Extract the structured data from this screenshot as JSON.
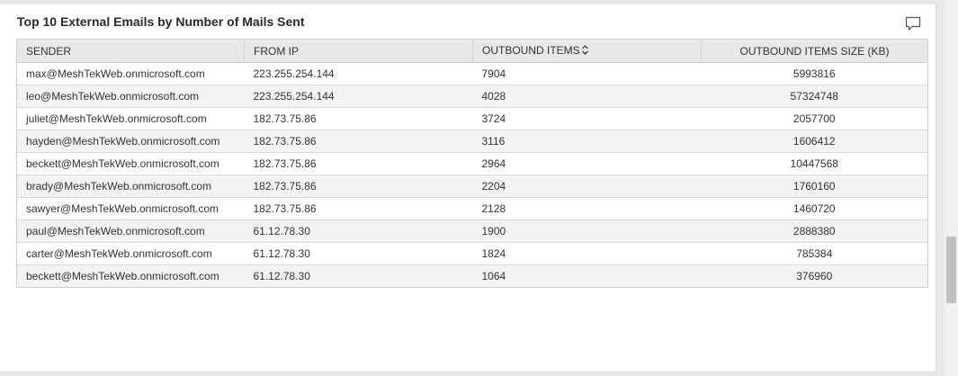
{
  "panel": {
    "title": "Top 10 External Emails by Number of Mails Sent",
    "comment_icon": "comment-icon"
  },
  "table": {
    "headers": {
      "sender": "SENDER",
      "from_ip": "FROM IP",
      "outbound_items": "OUTBOUND ITEMS",
      "outbound_items_size": "OUTBOUND ITEMS SIZE (KB)"
    },
    "sort_icon": "sort-icon",
    "rows": [
      {
        "sender": "max@MeshTekWeb.onmicrosoft.com",
        "from_ip": "223.255.254.144",
        "outbound_items": "7904",
        "outbound_items_size": "5993816"
      },
      {
        "sender": "leo@MeshTekWeb.onmicrosoft.com",
        "from_ip": "223.255.254.144",
        "outbound_items": "4028",
        "outbound_items_size": "57324748"
      },
      {
        "sender": "juliet@MeshTekWeb.onmicrosoft.com",
        "from_ip": "182.73.75.86",
        "outbound_items": "3724",
        "outbound_items_size": "2057700"
      },
      {
        "sender": "hayden@MeshTekWeb.onmicrosoft.com",
        "from_ip": "182.73.75.86",
        "outbound_items": "3116",
        "outbound_items_size": "1606412"
      },
      {
        "sender": "beckett@MeshTekWeb.onmicrosoft.com",
        "from_ip": "182.73.75.86",
        "outbound_items": "2964",
        "outbound_items_size": "10447568"
      },
      {
        "sender": "brady@MeshTekWeb.onmicrosoft.com",
        "from_ip": "182.73.75.86",
        "outbound_items": "2204",
        "outbound_items_size": "1760160"
      },
      {
        "sender": "sawyer@MeshTekWeb.onmicrosoft.com",
        "from_ip": "182.73.75.86",
        "outbound_items": "2128",
        "outbound_items_size": "1460720"
      },
      {
        "sender": "paul@MeshTekWeb.onmicrosoft.com",
        "from_ip": "61.12.78.30",
        "outbound_items": "1900",
        "outbound_items_size": "2888380"
      },
      {
        "sender": "carter@MeshTekWeb.onmicrosoft.com",
        "from_ip": "61.12.78.30",
        "outbound_items": "1824",
        "outbound_items_size": "785384"
      },
      {
        "sender": "beckett@MeshTekWeb.onmicrosoft.com",
        "from_ip": "61.12.78.30",
        "outbound_items": "1064",
        "outbound_items_size": "376960"
      }
    ]
  },
  "colors": {
    "header_bg": "#e8e8e8",
    "row_alt_bg": "#f3f3f3",
    "border": "#cfcfcf"
  }
}
